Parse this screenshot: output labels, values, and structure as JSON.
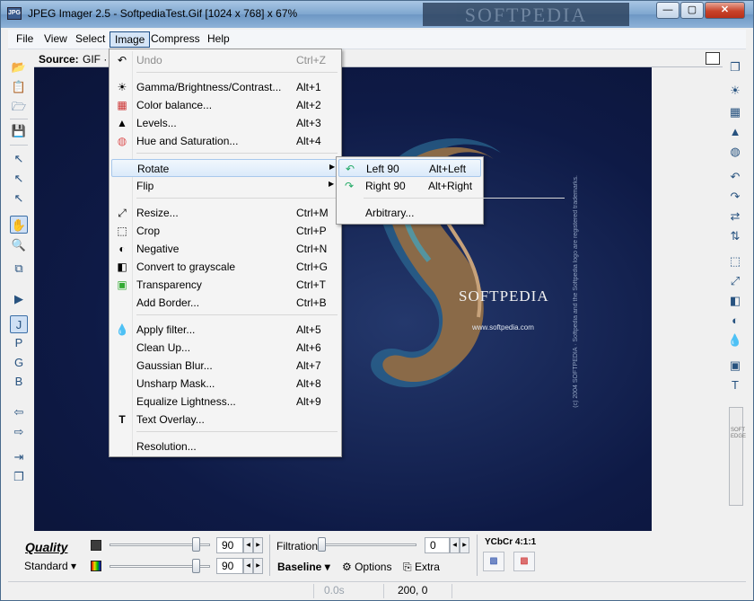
{
  "window": {
    "title": "JPEG Imager 2.5 - SoftpediaTest.Gif [1024 x 768] x 67%",
    "watermark": "SOFTPEDIA",
    "app_icon_text": "JPG"
  },
  "menubar": {
    "items": [
      "File",
      "View",
      "Select",
      "Image",
      "Compress",
      "Help"
    ]
  },
  "source": {
    "label": "Source:",
    "value": "GIF · 1"
  },
  "image_menu": {
    "items": [
      {
        "label": "Undo",
        "shortcut": "Ctrl+Z",
        "icon": "undo-icon"
      },
      {
        "label": "Gamma/Brightness/Contrast...",
        "shortcut": "Alt+1",
        "icon": "brightness-icon"
      },
      {
        "label": "Color balance...",
        "shortcut": "Alt+2",
        "icon": "color-balance-icon"
      },
      {
        "label": "Levels...",
        "shortcut": "Alt+3",
        "icon": "levels-icon"
      },
      {
        "label": "Hue and Saturation...",
        "shortcut": "Alt+4",
        "icon": "hue-icon"
      },
      {
        "label": "Rotate",
        "icon": "rotate-icon"
      },
      {
        "label": "Flip",
        "icon": "flip-icon"
      },
      {
        "label": "Resize...",
        "shortcut": "Ctrl+M",
        "icon": "resize-icon"
      },
      {
        "label": "Crop",
        "shortcut": "Ctrl+P",
        "icon": "crop-icon"
      },
      {
        "label": "Negative",
        "shortcut": "Ctrl+N",
        "icon": "negative-icon"
      },
      {
        "label": "Convert to grayscale",
        "shortcut": "Ctrl+G",
        "icon": "grayscale-icon"
      },
      {
        "label": "Transparency",
        "shortcut": "Ctrl+T",
        "icon": "transparency-icon"
      },
      {
        "label": "Add Border...",
        "shortcut": "Ctrl+B",
        "icon": "border-icon"
      },
      {
        "label": "Apply filter...",
        "shortcut": "Alt+5",
        "icon": "filter-icon"
      },
      {
        "label": "Clean Up...",
        "shortcut": "Alt+6",
        "icon": "cleanup-icon"
      },
      {
        "label": "Gaussian Blur...",
        "shortcut": "Alt+7",
        "icon": "blur-icon"
      },
      {
        "label": "Unsharp Mask...",
        "shortcut": "Alt+8",
        "icon": "unsharp-icon"
      },
      {
        "label": "Equalize Lightness...",
        "shortcut": "Alt+9",
        "icon": "equalize-icon"
      },
      {
        "label": "Text Overlay...",
        "icon": "text-overlay-icon"
      },
      {
        "label": "Resolution...",
        "icon": "resolution-icon"
      }
    ]
  },
  "rotate_submenu": {
    "items": [
      {
        "label": "Left 90",
        "shortcut": "Alt+Left",
        "icon": "rotate-left-icon"
      },
      {
        "label": "Right 90",
        "shortcut": "Alt+Right",
        "icon": "rotate-right-icon"
      },
      {
        "label": "Arbitrary...",
        "icon": ""
      }
    ]
  },
  "canvas": {
    "brand": "SOFTPEDIA",
    "url": "www.softpedia.com",
    "vertical": "(c) 2004 SOFTPEDIA · Softpedia and the Softpedia logo are registered trademarks."
  },
  "right_panel": {
    "soft_edge": "SOFT EDGE"
  },
  "bottom": {
    "quality_label": "Quality",
    "mode": "Standard ▾",
    "quality_value_1": "90",
    "quality_value_2": "90",
    "quality_level": 0.9,
    "filtration_label": "Filtration",
    "filtration_value": "0",
    "baseline": "Baseline ▾",
    "options": "Options",
    "extra": "Extra",
    "subsampling": "YCbCr 4:1:1"
  },
  "status": {
    "time": "0.0s",
    "coords": "200, 0"
  }
}
